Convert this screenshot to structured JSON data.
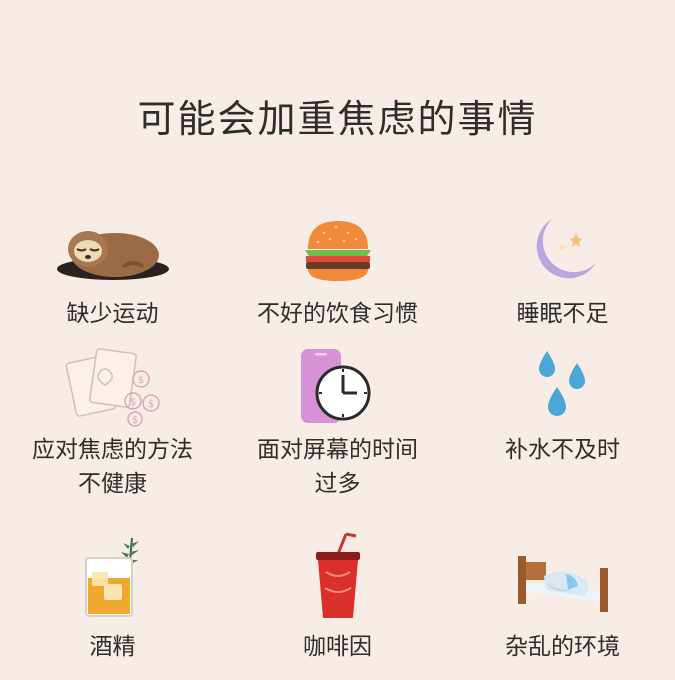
{
  "title": "可能会加重焦虑的事情",
  "items": [
    {
      "lines": [
        "缺少运动"
      ],
      "icon": "sleeping-sloth-icon"
    },
    {
      "lines": [
        "不好的饮食习惯"
      ],
      "icon": "burger-icon"
    },
    {
      "lines": [
        "睡眠不足"
      ],
      "icon": "crescent-moon-icon"
    },
    {
      "lines": [
        "应对焦虑的方法",
        "不健康"
      ],
      "icon": "cards-and-coins-icon"
    },
    {
      "lines": [
        "面对屏幕的时间",
        "过多"
      ],
      "icon": "phone-clock-icon"
    },
    {
      "lines": [
        "补水不及时"
      ],
      "icon": "water-drops-icon"
    },
    {
      "lines": [
        "酒精"
      ],
      "icon": "whiskey-glass-icon"
    },
    {
      "lines": [
        "咖啡因"
      ],
      "icon": "soda-cup-icon"
    },
    {
      "lines": [
        "杂乱的环境"
      ],
      "icon": "messy-bed-icon"
    }
  ],
  "colors": {
    "background": "#f8ece6",
    "text": "#2d2d2d",
    "moon": "#b9a6dc",
    "phone": "#d890d6",
    "drops": "#4aa7d8"
  }
}
